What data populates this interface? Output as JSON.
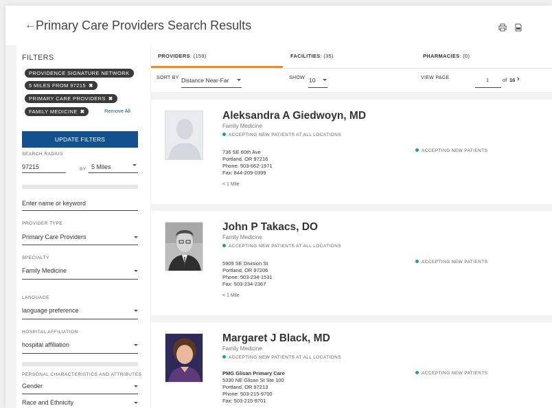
{
  "header": {
    "title": "Primary Care Providers Search Results",
    "back_icon": "arrow-left-icon",
    "print_icon": "print-icon",
    "pdf_icon": "pdf-icon"
  },
  "sidebar": {
    "filters_title": "FILTERS",
    "chips": [
      {
        "label": "PROVIDENCE SIGNATURE NETWORK",
        "removable": false
      },
      {
        "label": "5 MILES FROM 97215",
        "removable": true
      },
      {
        "label": "PRIMARY CARE PROVIDERS",
        "removable": true
      },
      {
        "label": "FAMILY MEDICINE",
        "removable": true
      }
    ],
    "chip_remove_glyph": "✖",
    "remove_all": "Remove All",
    "update_button": "UPDATE FILTERS",
    "search_radius_label": "SEARCH RADIUS",
    "zip_value": "97215",
    "by_label": "BY",
    "radius_value": "5 Miles",
    "name_placeholder": "Enter name or keyword",
    "provider_type_label": "PROVIDER TYPE",
    "provider_type_value": "Primary Care Providers",
    "specialty_label": "SPECIALTY",
    "specialty_value": "Family Medicine",
    "language_label": "LANGUAGE",
    "language_value": "language preference",
    "hospital_label": "HOSPITAL AFFILIATION",
    "hospital_value": "hospital affiliation",
    "personal_label": "PERSONAL CHARACTERISTICS AND ATTRIBUTES",
    "gender_value": "Gender",
    "race_value": "Race and Ethnicity"
  },
  "tabs": [
    {
      "label": "PROVIDERS",
      "count": ": (159)",
      "active": true
    },
    {
      "label": "FACILITIES",
      "count": ": (35)",
      "active": false
    },
    {
      "label": "PHARMACIES",
      "count": ": (0)",
      "active": false
    }
  ],
  "sortbar": {
    "sort_label": "SORT BY",
    "sort_value": "Distance Near-Far",
    "show_label": "SHOW",
    "show_value": "10",
    "view_page_label": "VIEW PAGE",
    "page_value": "1",
    "of_label": "of",
    "total_pages": "16",
    "next_glyph": "›"
  },
  "providers": [
    {
      "name": "Aleksandra A Giedwoyn, MD",
      "specialty": "Family Medicine",
      "accepting_all": "ACCEPTING NEW PATIENTS AT ALL LOCATIONS",
      "clinic": "",
      "address1": "736 SE 60th Ave",
      "address2": "Portland, OR 97216",
      "phone": "Phone: 503-662-1971",
      "fax": "Fax: 844-209-0399",
      "distance": "< 1 Mile",
      "accepting_location": "ACCEPTING NEW PATIENTS",
      "photo": "placeholder-avatar"
    },
    {
      "name": "John P Takacs, DO",
      "specialty": "Family Medicine",
      "accepting_all": "ACCEPTING NEW PATIENTS AT ALL LOCATIONS",
      "clinic": "",
      "address1": "5909 SE Division St",
      "address2": "Portland, OR 97206",
      "phone": "Phone: 503-234-1531",
      "fax": "Fax: 503-234-2367",
      "distance": "< 1 Mile",
      "accepting_location": "ACCEPTING NEW PATIENTS",
      "photo": "grayscale-headshot"
    },
    {
      "name": "Margaret J Black, MD",
      "specialty": "Family Medicine",
      "accepting_all": "ACCEPTING NEW PATIENTS AT ALL LOCATIONS",
      "clinic": "PMG Glisan Primary Care",
      "address1": "5330 NE Glisan St Ste 100",
      "address2": "Portland, OR 97213",
      "phone": "Phone: 503-215-9700",
      "fax": "Fax: 503-215-9701",
      "distance": "",
      "accepting_location": "ACCEPTING NEW PATIENTS",
      "photo": "color-headshot"
    }
  ],
  "colors": {
    "primary": "#12508e",
    "accent": "#f08a1c",
    "accepting_dot": "#1aa38c",
    "chip_bg": "#3a3a3a"
  }
}
